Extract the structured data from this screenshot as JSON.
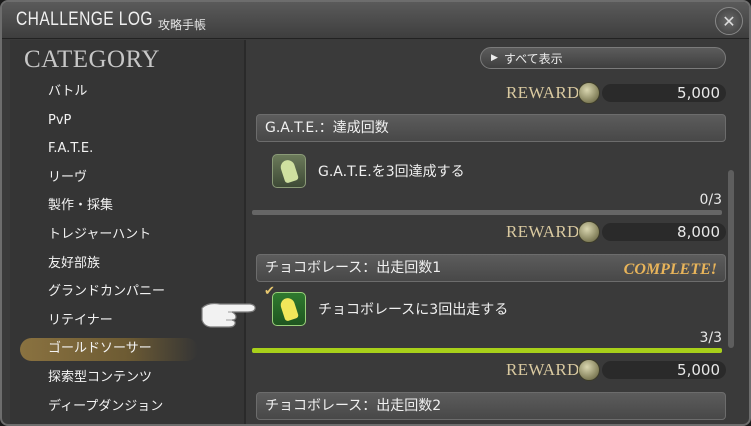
{
  "window": {
    "title": "CHALLENGE LOG",
    "subtitle": "攻略手帳"
  },
  "sidebar": {
    "title": "CATEGORY",
    "items": [
      {
        "label": "バトル"
      },
      {
        "label": "PvP"
      },
      {
        "label": "F.A.T.E."
      },
      {
        "label": "リーヴ"
      },
      {
        "label": "製作・採集"
      },
      {
        "label": "トレジャーハント"
      },
      {
        "label": "友好部族"
      },
      {
        "label": "グランドカンパニー"
      },
      {
        "label": "リテイナー"
      },
      {
        "label": "ゴールドソーサー",
        "active": true
      },
      {
        "label": "探索型コンテンツ"
      },
      {
        "label": "ディープダンジョン"
      }
    ]
  },
  "main": {
    "filter_label": "すべて表示",
    "reward_label": "REWARD",
    "top_reward": "5,000",
    "sections": [
      {
        "header": "G.A.T.E.：達成回数",
        "task": "G.A.T.E.を3回達成する",
        "progress_text": "0/3",
        "progress": 0,
        "reward": "8,000",
        "complete": false
      },
      {
        "header": "チョコボレース：出走回数1",
        "complete_label": "COMPLETE!",
        "task": "チョコボレースに3回出走する",
        "progress_text": "3/3",
        "progress": 1,
        "reward": "5,000",
        "complete": true
      },
      {
        "header": "チョコボレース：出走回数2"
      }
    ]
  },
  "colors": {
    "accent_gold": "#e8b45a",
    "progress_green": "#a8d01a"
  },
  "icons": [
    "close-icon",
    "coin-icon",
    "chocobo-icon",
    "check-icon",
    "pointer-hand-icon",
    "play-arrow-icon"
  ]
}
